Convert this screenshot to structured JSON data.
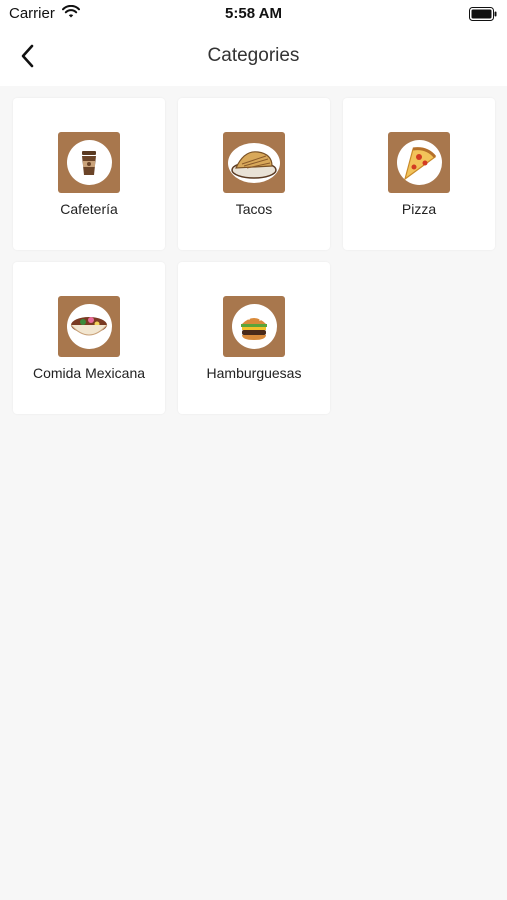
{
  "status_bar": {
    "carrier": "Carrier",
    "time": "5:58 AM"
  },
  "header": {
    "title": "Categories",
    "back_icon": "chevron-left-icon"
  },
  "categories": [
    {
      "label": "Cafetería",
      "icon": "coffee-cup-icon"
    },
    {
      "label": "Tacos",
      "icon": "taco-icon"
    },
    {
      "label": "Pizza",
      "icon": "pizza-slice-icon"
    },
    {
      "label": "Comida Mexicana",
      "icon": "mexican-bowl-icon"
    },
    {
      "label": "Hamburguesas",
      "icon": "hamburger-icon"
    }
  ],
  "colors": {
    "tile_background": "#a8774d",
    "page_background": "#f7f7f7",
    "card_background": "#ffffff"
  }
}
